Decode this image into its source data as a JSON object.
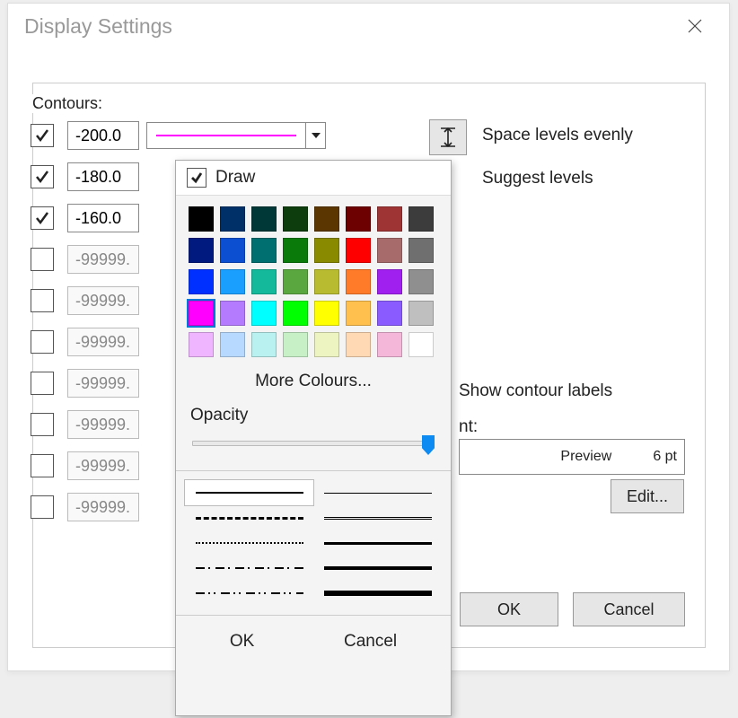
{
  "window": {
    "title": "Display Settings",
    "close_label": "Close"
  },
  "section_label": "Contours:",
  "rows": [
    {
      "checked": true,
      "value": "-200.0",
      "color": "#ff00ff"
    },
    {
      "checked": true,
      "value": "-180.0"
    },
    {
      "checked": true,
      "value": "-160.0"
    },
    {
      "checked": false,
      "value": "-99999."
    },
    {
      "checked": false,
      "value": "-99999."
    },
    {
      "checked": false,
      "value": "-99999."
    },
    {
      "checked": false,
      "value": "-99999."
    },
    {
      "checked": false,
      "value": "-99999."
    },
    {
      "checked": false,
      "value": "-99999."
    },
    {
      "checked": false,
      "value": "-99999."
    }
  ],
  "right": {
    "space_label": "Space levels evenly",
    "suggest_label": "Suggest levels",
    "show_labels_label": "Show contour labels",
    "font_label": "nt:"
  },
  "preview": {
    "label": "Preview",
    "size": "6 pt"
  },
  "buttons": {
    "edit": "Edit...",
    "ok": "OK",
    "cancel": "Cancel"
  },
  "popup": {
    "draw_label": "Draw",
    "draw_checked": true,
    "more_label": "More Colours...",
    "opacity_label": "Opacity",
    "opacity_value": 100,
    "ok": "OK",
    "cancel": "Cancel",
    "selected_color": "#ff00ff",
    "colors": [
      "#000000",
      "#003068",
      "#003838",
      "#0d3d0d",
      "#5c3600",
      "#6d0000",
      "#9e3434",
      "#3c3c3c",
      "#001a80",
      "#0d4fd1",
      "#006f6f",
      "#0a7a0a",
      "#8a8a00",
      "#ff0000",
      "#a86b6b",
      "#6f6f6f",
      "#0030ff",
      "#1a9fff",
      "#14b89a",
      "#5aa63f",
      "#b8bb2f",
      "#ff7a29",
      "#a020f0",
      "#8f8f8f",
      "#ff00ff",
      "#b57bff",
      "#00ffff",
      "#00ff00",
      "#ffff00",
      "#ffc04d",
      "#8a5cff",
      "#bfbfbf",
      "#efb6ff",
      "#b8d9ff",
      "#b8f1ef",
      "#c7f0c7",
      "#eef3c2",
      "#ffd9b3",
      "#f4b6d9",
      "#ffffff"
    ],
    "line_styles": [
      {
        "thickness": 2,
        "dash": "solid",
        "selected": true
      },
      {
        "thickness": 1,
        "dash": "solid"
      },
      {
        "thickness": 3,
        "dash": "dashed-wide"
      },
      {
        "thickness": 1.5,
        "dash": "double"
      },
      {
        "thickness": 2,
        "dash": "dotted"
      },
      {
        "thickness": 3,
        "dash": "solid"
      },
      {
        "thickness": 2,
        "dash": "dashdot"
      },
      {
        "thickness": 4,
        "dash": "solid"
      },
      {
        "thickness": 2,
        "dash": "dashdotdot"
      },
      {
        "thickness": 6,
        "dash": "solid"
      }
    ]
  }
}
